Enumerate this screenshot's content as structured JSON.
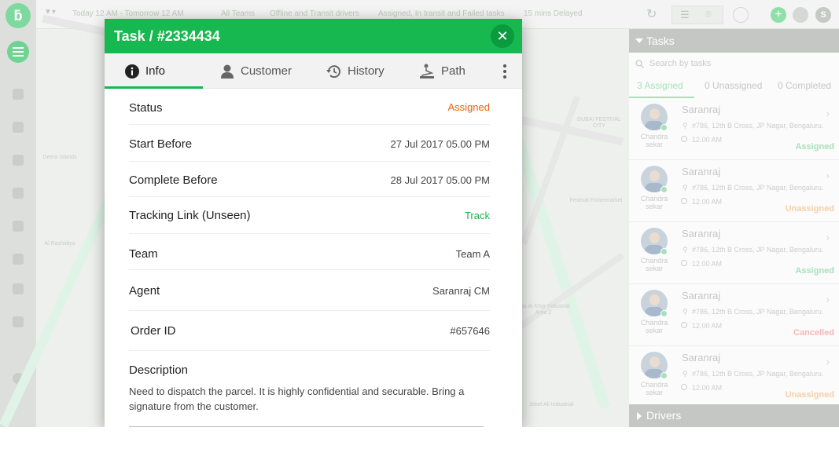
{
  "topbar": {
    "filters": [
      "Today 12 AM - Tomorrow 12 AM",
      "All Teams",
      "Offline and Transit drivers",
      "Assigned, In transit and Failed tasks",
      "15 mins Delayed"
    ],
    "avatar_letter": "S"
  },
  "map": {
    "labels": [
      "DUBAI FESTIVAL CITY",
      "Festival Fishermarket",
      "Deera Islands",
      "Al Rashidiya",
      "Ras Al Khor Industrial Area 2",
      "Jebel Ali Industrial"
    ]
  },
  "modal": {
    "title": "Task / #2334434",
    "tabs": [
      "Info",
      "Customer",
      "History",
      "Path"
    ],
    "rows": {
      "status": {
        "label": "Status",
        "value": "Assigned"
      },
      "start": {
        "label": "Start Before",
        "value": "27 Jul 2017  05.00 PM"
      },
      "complete": {
        "label": "Complete Before",
        "value": "28 Jul 2017  05.00 PM"
      },
      "tracking": {
        "label": "Tracking Link (Unseen)",
        "value": "Track"
      },
      "team": {
        "label": "Team",
        "value": "Team A"
      },
      "agent": {
        "label": "Agent",
        "value": "Saranraj CM"
      },
      "order": {
        "label": "Order ID",
        "value": "#657646"
      }
    },
    "description": {
      "label": "Description",
      "text": "Need to dispatch the parcel. It is highly confidential and securable. Bring a signature from the customer."
    }
  },
  "tasks_panel": {
    "title": "Tasks",
    "search_placeholder": "Search by tasks",
    "tabs": [
      "3 Assigned",
      "0 Unassigned",
      "0 Completed"
    ],
    "cards": [
      {
        "name": "Saranraj",
        "address": "#786, 12th B Cross, JP Nagar, Bengaluru.",
        "time": "12.00 AM",
        "agent": "Chandra sekar",
        "status": "Assigned",
        "status_color": "#a8e0bb"
      },
      {
        "name": "Saranraj",
        "address": "#786, 12th B Cross, JP Nagar, Bengaluru.",
        "time": "12.00 AM",
        "agent": "Chandra sekar",
        "status": "Unassigned",
        "status_color": "#f5cfa8"
      },
      {
        "name": "Saranraj",
        "address": "#786, 12th B Cross, JP Nagar, Bengaluru.",
        "time": "12.00 AM",
        "agent": "Chandra sekar",
        "status": "Assigned",
        "status_color": "#a8e0bb"
      },
      {
        "name": "Saranraj",
        "address": "#786, 12th B Cross, JP Nagar, Bengaluru.",
        "time": "12.00 AM",
        "agent": "Chandra sekar",
        "status": "Cancelled",
        "status_color": "#f4b7b7"
      },
      {
        "name": "Saranraj",
        "address": "#786, 12th B Cross, JP Nagar, Bengaluru.",
        "time": "12.00 AM",
        "agent": "Chandra sekar",
        "status": "Unassigned",
        "status_color": "#f5cfa8"
      }
    ],
    "drivers_label": "Drivers"
  },
  "colors": {
    "brand_green": "#17b84f",
    "status_assigned": "#e8620c",
    "track_link": "#17b84f"
  }
}
